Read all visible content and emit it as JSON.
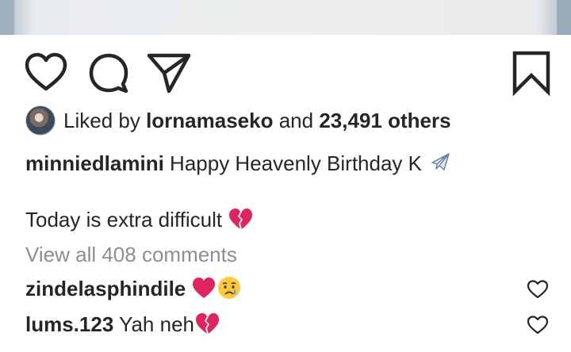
{
  "post": {
    "likes": {
      "prefix": "Liked by",
      "liker": "lornamaseko",
      "connector": "and",
      "others": "23,491 others"
    },
    "caption": {
      "username": "minniedlamini",
      "text": "Happy Heavenly Birthday K",
      "emoji": "airplane",
      "line2": "Today is extra difficult",
      "line2_emoji": "broken-heart"
    },
    "view_comments": "View all 408 comments",
    "comments": [
      {
        "username": "zindelasphindile",
        "text": "",
        "emojis": [
          "red-heart",
          "crying-face"
        ]
      },
      {
        "username": "lums.123",
        "text": "Yah neh",
        "emojis": [
          "broken-heart"
        ]
      }
    ]
  },
  "icons": {
    "like": "heart-icon",
    "comment": "comment-bubble-icon",
    "share": "paper-plane-icon",
    "save": "bookmark-icon"
  },
  "colors": {
    "text": "#262626",
    "muted": "#8e8e8e",
    "heart_red": "#e0245e"
  }
}
